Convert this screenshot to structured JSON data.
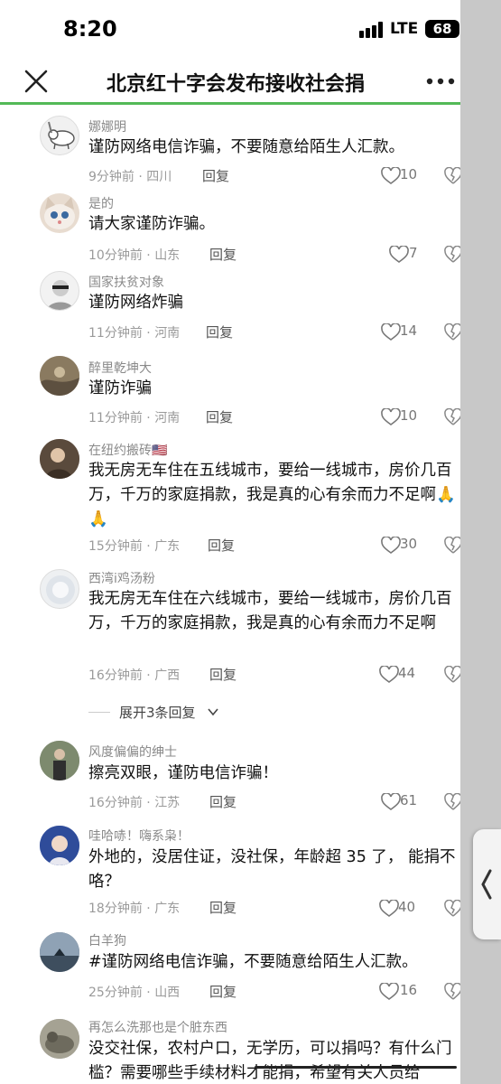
{
  "status_bar": {
    "time": "8:20",
    "network": "LTE",
    "battery": "68"
  },
  "header": {
    "title": "北京红十字会发布接收社会捐",
    "close_icon": "close-icon",
    "more_icon": "more-icon",
    "accent": "#53b957"
  },
  "comments": [
    {
      "user": "娜娜明",
      "text": "谨防网络电信诈骗，不要随意给陌生人汇款。",
      "time": "9分钟前",
      "region": "四川",
      "reply": "回复",
      "likes": "10"
    },
    {
      "user": "是的",
      "text": "请大家谨防诈骗。",
      "time": "10分钟前",
      "region": "山东",
      "reply": "回复",
      "likes": "7"
    },
    {
      "user": "国家扶贫对象",
      "text": "谨防网络炸骗",
      "time": "11分钟前",
      "region": "河南",
      "reply": "回复",
      "likes": "14"
    },
    {
      "user": "醉里乾坤大",
      "text": "谨防诈骗",
      "time": "11分钟前",
      "region": "河南",
      "reply": "回复",
      "likes": "10"
    },
    {
      "user": "在纽约搬砖🇺🇸",
      "text": "我无房无车住在五线城市，要给一线城市，房价几百万，千万的家庭捐款，我是真的心有余而力不足啊🙏🙏",
      "time": "15分钟前",
      "region": "广东",
      "reply": "回复",
      "likes": "30"
    },
    {
      "user": "西湾i鸡汤粉",
      "text": "我无房无车住在六线城市，要给一线城市，房价几百万，千万的家庭捐款，我是真的心有余而力不足啊",
      "time": "16分钟前",
      "region": "广西",
      "reply": "回复",
      "likes": "44"
    },
    {
      "user": "风度偏偏的绅士",
      "text": "擦亮双眼，谨防电信诈骗！",
      "time": "16分钟前",
      "region": "江苏",
      "reply": "回复",
      "likes": "61"
    },
    {
      "user": "哇哈哧！嗨系枭！",
      "text": "外地的，没居住证，没社保，年龄超 35 了， 能捐不咯？",
      "time": "18分钟前",
      "region": "广东",
      "reply": "回复",
      "likes": "40"
    },
    {
      "user": "白羊狗",
      "text": "#谨防网络电信诈骗，不要随意给陌生人汇款。",
      "time": "25分钟前",
      "region": "山西",
      "reply": "回复",
      "likes": "16"
    },
    {
      "user": "再怎么洗那也是个脏东西",
      "text": "没交社保，农村户口，无学历，可以捐吗？有什么门槛？需要哪些手续材料才能捐，希望有关人员给",
      "time": "",
      "region": "",
      "reply": "",
      "likes": ""
    }
  ],
  "expand_replies": "展开3条回复",
  "colors": {
    "like_icon": "#777777",
    "text": "#111111",
    "meta": "#9a9a9a"
  }
}
